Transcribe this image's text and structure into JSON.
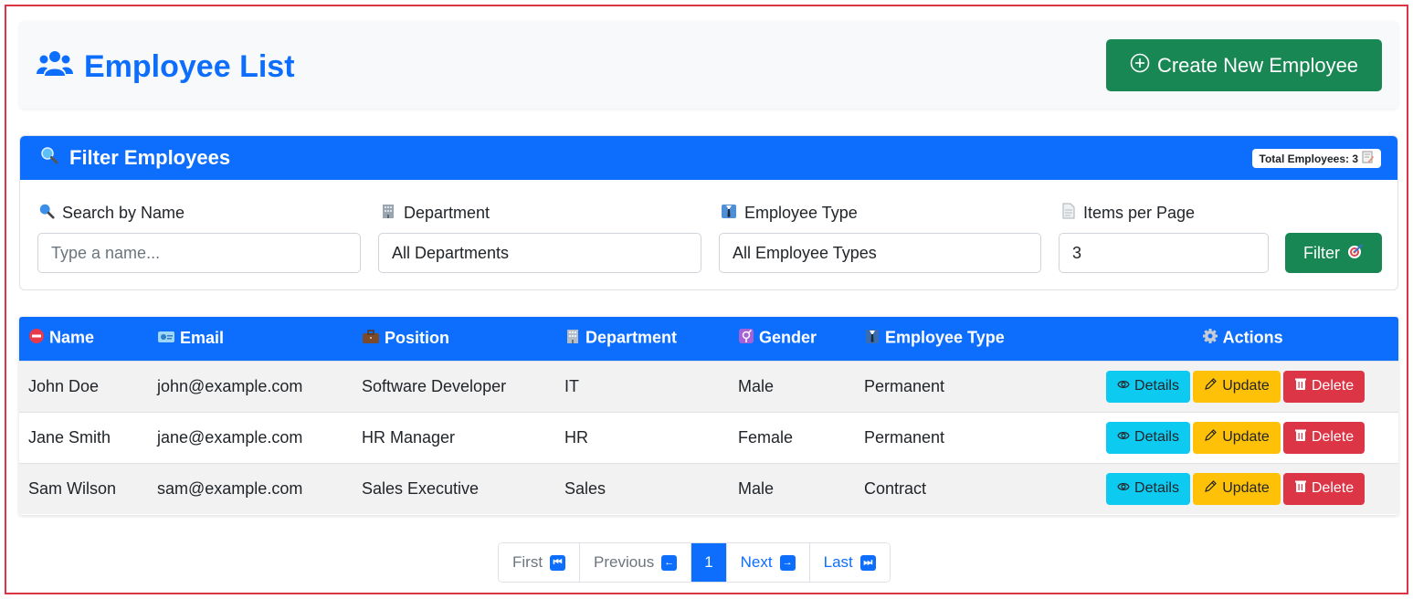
{
  "header": {
    "title": "Employee List",
    "create_label": "Create New Employee"
  },
  "filter": {
    "heading": "Filter Employees",
    "total_badge": "Total Employees: 3",
    "search_label": "Search by Name",
    "search_placeholder": "Type a name...",
    "department_label": "Department",
    "department_value": "All Departments",
    "type_label": "Employee Type",
    "type_value": "All Employee Types",
    "per_page_label": "Items per Page",
    "per_page_value": "3",
    "filter_button": "Filter"
  },
  "table": {
    "headers": [
      "Name",
      "Email",
      "Position",
      "Department",
      "Gender",
      "Employee Type",
      "Actions"
    ],
    "rows": [
      {
        "name": "John Doe",
        "email": "john@example.com",
        "position": "Software Developer",
        "department": "IT",
        "gender": "Male",
        "type": "Permanent"
      },
      {
        "name": "Jane Smith",
        "email": "jane@example.com",
        "position": "HR Manager",
        "department": "HR",
        "gender": "Female",
        "type": "Permanent"
      },
      {
        "name": "Sam Wilson",
        "email": "sam@example.com",
        "position": "Sales Executive",
        "department": "Sales",
        "gender": "Male",
        "type": "Contract"
      }
    ],
    "actions": {
      "details": "Details",
      "update": "Update",
      "delete": "Delete"
    }
  },
  "pagination": {
    "first": "First",
    "previous": "Previous",
    "current": "1",
    "next": "Next",
    "last": "Last"
  },
  "colors": {
    "primary": "#0d6efd",
    "success": "#198754",
    "info": "#0dcaf0",
    "warning": "#ffc107",
    "danger": "#dc3545"
  }
}
